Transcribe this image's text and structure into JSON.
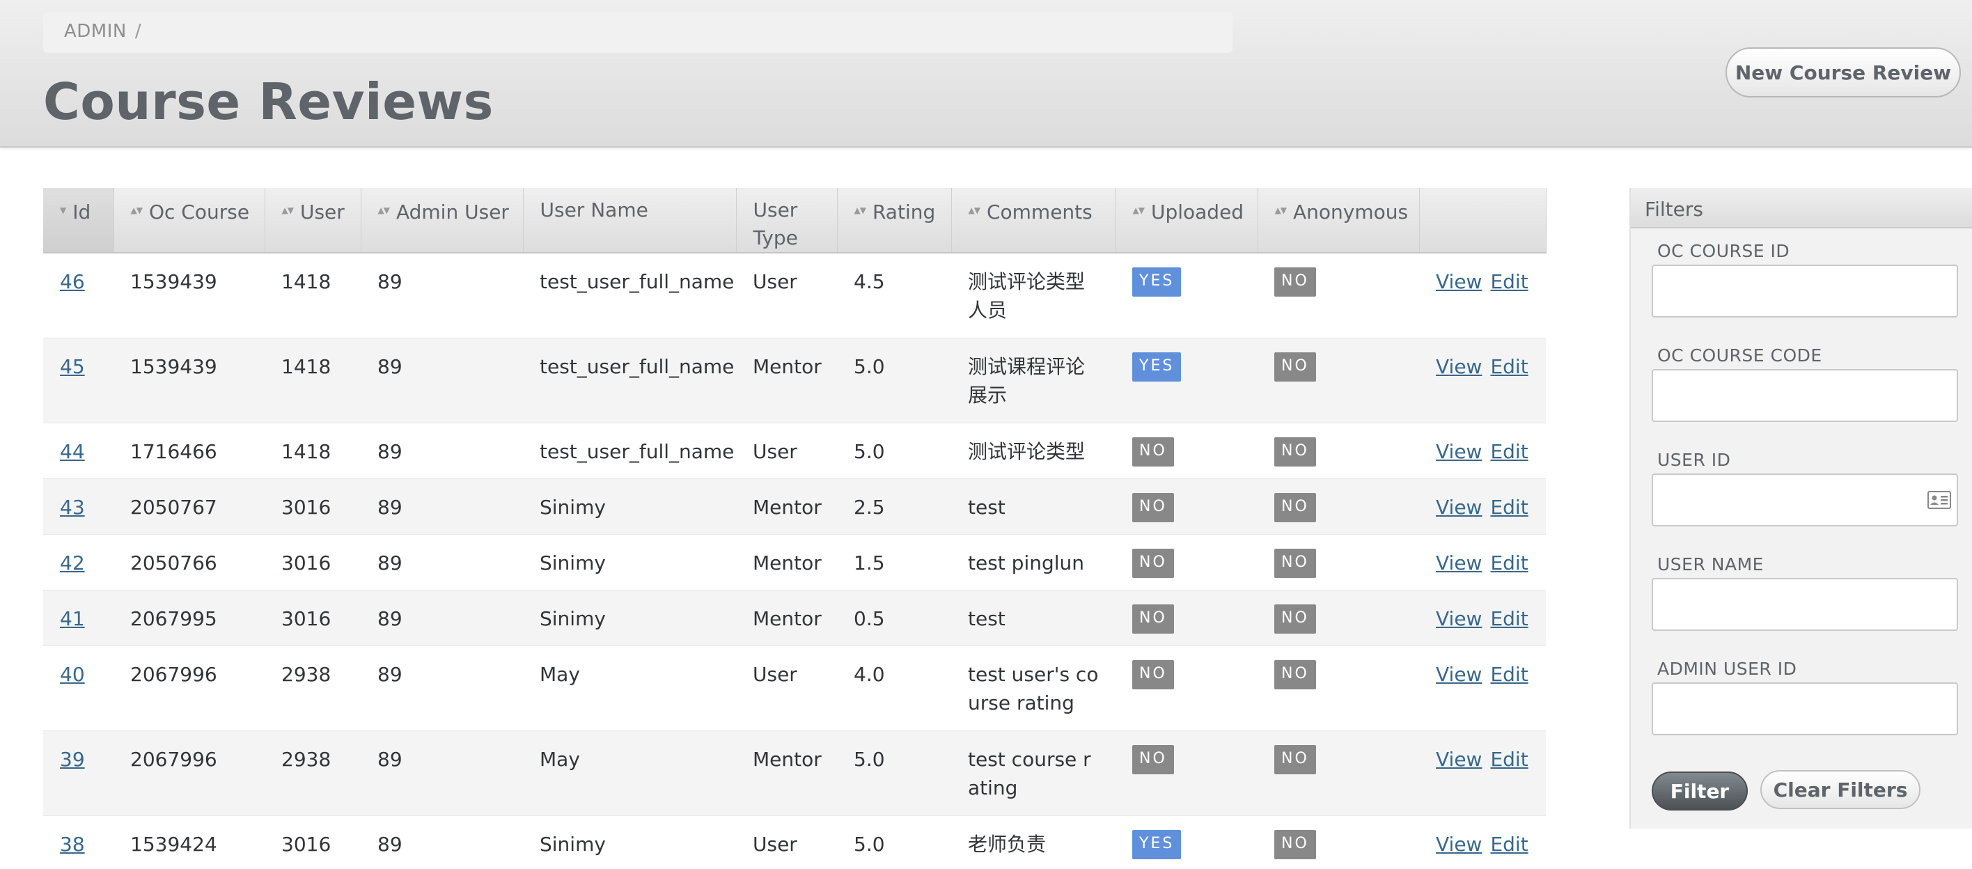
{
  "breadcrumb": {
    "root": "ADMIN",
    "separator": "/"
  },
  "page": {
    "title": "Course Reviews",
    "new_button": "New Course Review"
  },
  "table": {
    "columns": [
      "Id",
      "Oc Course",
      "User",
      "Admin User",
      "User Name",
      "User Type",
      "Rating",
      "Comments",
      "Uploaded",
      "Anonymous",
      ""
    ],
    "view_label": "View",
    "edit_label": "Edit",
    "rows": [
      {
        "id": "46",
        "oc_course": "1539439",
        "user": "1418",
        "admin_user": "89",
        "user_name": "test_user_full_name",
        "user_type": "User",
        "rating": "4.5",
        "comments": "测试评论类型人员",
        "uploaded": "YES",
        "anonymous": "NO"
      },
      {
        "id": "45",
        "oc_course": "1539439",
        "user": "1418",
        "admin_user": "89",
        "user_name": "test_user_full_name",
        "user_type": "Mentor",
        "rating": "5.0",
        "comments": "测试课程评论展示",
        "uploaded": "YES",
        "anonymous": "NO"
      },
      {
        "id": "44",
        "oc_course": "1716466",
        "user": "1418",
        "admin_user": "89",
        "user_name": "test_user_full_name",
        "user_type": "User",
        "rating": "5.0",
        "comments": "测试评论类型",
        "uploaded": "NO",
        "anonymous": "NO"
      },
      {
        "id": "43",
        "oc_course": "2050767",
        "user": "3016",
        "admin_user": "89",
        "user_name": "Sinimy",
        "user_type": "Mentor",
        "rating": "2.5",
        "comments": "test",
        "uploaded": "NO",
        "anonymous": "NO"
      },
      {
        "id": "42",
        "oc_course": "2050766",
        "user": "3016",
        "admin_user": "89",
        "user_name": "Sinimy",
        "user_type": "Mentor",
        "rating": "1.5",
        "comments": "test pinglun",
        "uploaded": "NO",
        "anonymous": "NO"
      },
      {
        "id": "41",
        "oc_course": "2067995",
        "user": "3016",
        "admin_user": "89",
        "user_name": "Sinimy",
        "user_type": "Mentor",
        "rating": "0.5",
        "comments": "test",
        "uploaded": "NO",
        "anonymous": "NO"
      },
      {
        "id": "40",
        "oc_course": "2067996",
        "user": "2938",
        "admin_user": "89",
        "user_name": "May",
        "user_type": "User",
        "rating": "4.0",
        "comments": "test user's course rating",
        "uploaded": "NO",
        "anonymous": "NO"
      },
      {
        "id": "39",
        "oc_course": "2067996",
        "user": "2938",
        "admin_user": "89",
        "user_name": "May",
        "user_type": "Mentor",
        "rating": "5.0",
        "comments": "test course rating",
        "uploaded": "NO",
        "anonymous": "NO"
      },
      {
        "id": "38",
        "oc_course": "1539424",
        "user": "3016",
        "admin_user": "89",
        "user_name": "Sinimy",
        "user_type": "User",
        "rating": "5.0",
        "comments": "老师负责",
        "uploaded": "YES",
        "anonymous": "NO"
      }
    ]
  },
  "filters": {
    "title": "Filters",
    "oc_course_id_label": "OC COURSE ID",
    "oc_course_code_label": "OC COURSE CODE",
    "user_id_label": "USER ID",
    "user_name_label": "USER NAME",
    "admin_user_id_label": "ADMIN USER ID",
    "filter_button": "Filter",
    "clear_button": "Clear Filters"
  },
  "colors": {
    "uploaded_yes": "#6090db",
    "badge_no": "#888888",
    "link": "#38678b",
    "title": "#5e6469"
  },
  "icons": {
    "user_id_field": "contact-card-icon"
  }
}
